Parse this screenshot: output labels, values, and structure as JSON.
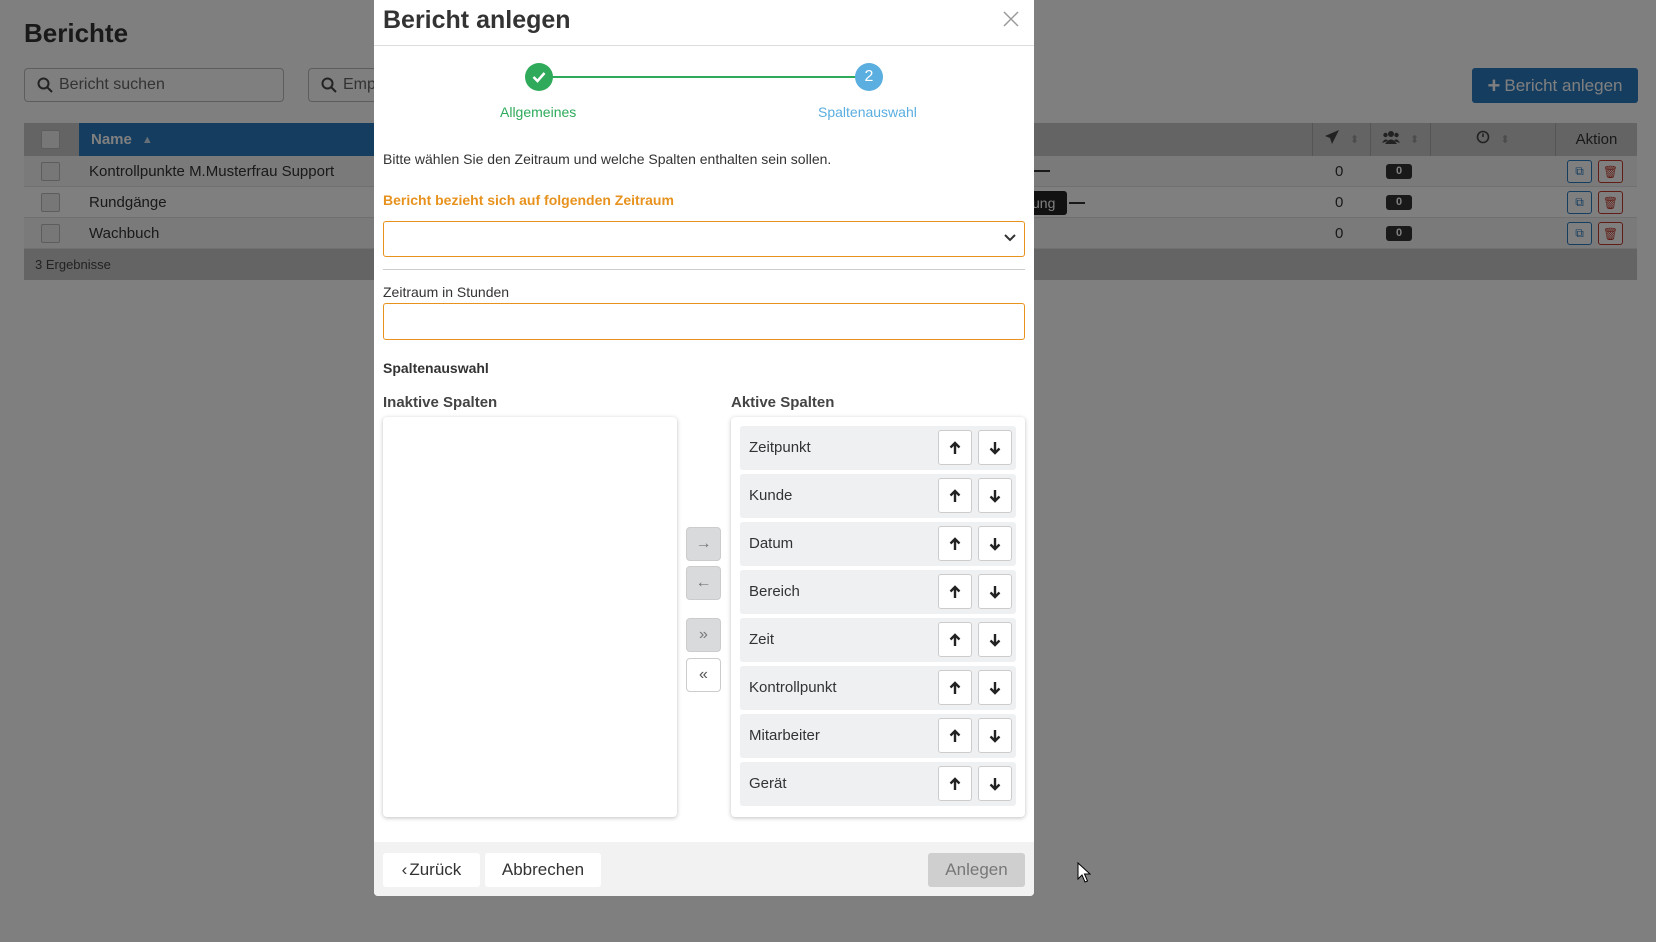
{
  "page": {
    "title": "Berichte",
    "search1_placeholder": "Bericht suchen",
    "search2_placeholder": "Emp",
    "new_button": "Bericht anlegen",
    "table": {
      "name_header": "Name",
      "aktion_header": "Aktion",
      "rows": [
        {
          "name": "Kontrollpunkte M.Musterfrau Support",
          "count": "0",
          "badge": "0"
        },
        {
          "name": "Rundgänge",
          "count": "0",
          "badge": "0"
        },
        {
          "name": "Wachbuch",
          "count": "0",
          "badge": "0"
        }
      ],
      "footer": "3 Ergebnisse"
    },
    "tooltip_fragment": "ung"
  },
  "modal": {
    "title": "Bericht anlegen",
    "steps": [
      {
        "number": "1",
        "label": "Allgemeines",
        "state": "done"
      },
      {
        "number": "2",
        "label": "Spaltenauswahl",
        "state": "active"
      }
    ],
    "intro": "Bitte wählen Sie den Zeitraum und welche Spalten enthalten sein sollen.",
    "range_label": "Bericht bezieht sich auf folgenden Zeitraum",
    "range_value": "",
    "hours_label": "Zeitraum in Stunden",
    "hours_value": "",
    "section_title": "Spaltenauswahl",
    "inactive_title": "Inaktive Spalten",
    "active_title": "Aktive Spalten",
    "inactive_columns": [],
    "active_columns": [
      "Zeitpunkt",
      "Kunde",
      "Datum",
      "Bereich",
      "Zeit",
      "Kontrollpunkt",
      "Mitarbeiter",
      "Gerät"
    ],
    "move_buttons": [
      "→",
      "←",
      "»",
      "«"
    ],
    "footer": {
      "back": "Zurück",
      "cancel": "Abbrechen",
      "create": "Anlegen"
    }
  },
  "colors": {
    "primary": "#2a7bc1",
    "success": "#2eaa5a",
    "step_active": "#5aaee0",
    "warning": "#e8921e",
    "danger": "#c0392b"
  }
}
